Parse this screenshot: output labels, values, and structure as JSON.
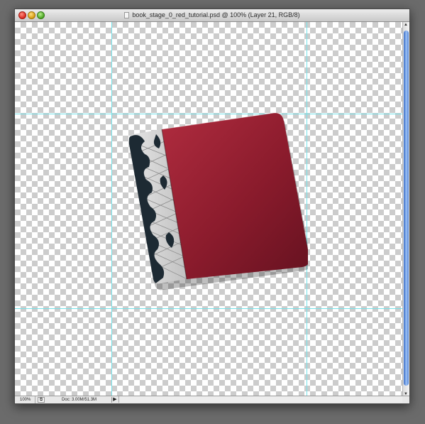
{
  "window": {
    "title": "book_stage_0_red_tutorial.psd @ 100% (Layer 21, RGB/8)"
  },
  "statusbar": {
    "zoom": "100%",
    "doc_info": "Doc: 3.00M/51.3M",
    "menu_arrow": "▶"
  },
  "colors": {
    "cover": "#a52a39",
    "cover_dark": "#6a1320",
    "spine_pattern": "#1d2a33",
    "guides": "#77e3ea"
  },
  "icons": {
    "close": "close-icon",
    "minimize": "minimize-icon",
    "maximize": "maximize-icon",
    "document": "document-icon"
  }
}
